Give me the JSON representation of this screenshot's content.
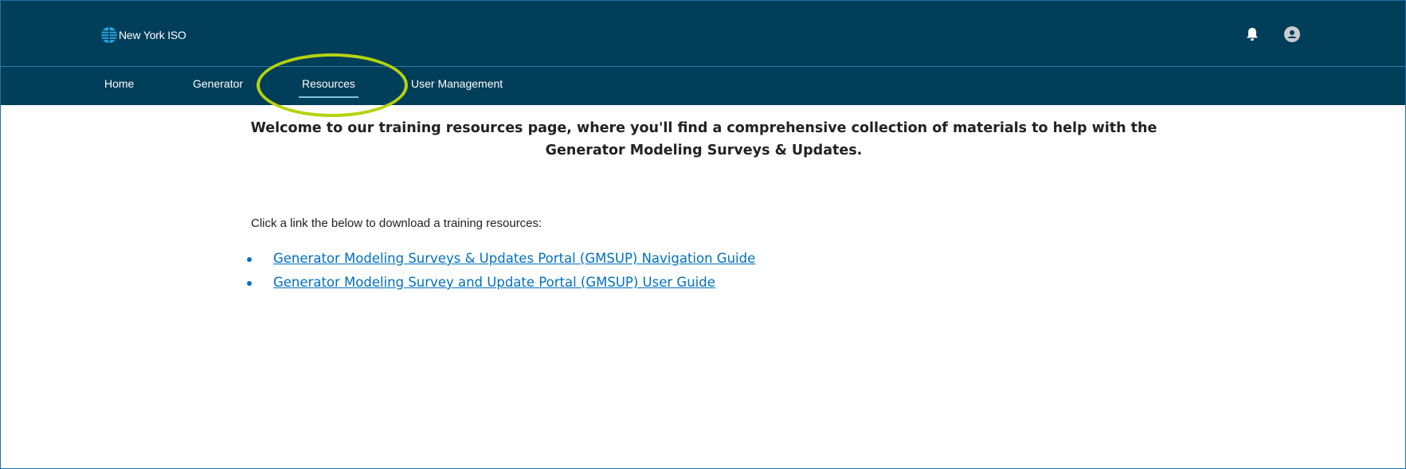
{
  "header": {
    "logo_text": "New York ISO",
    "icons": [
      "globe-logo-icon",
      "bell-icon",
      "user-avatar-icon"
    ]
  },
  "nav": {
    "items": [
      {
        "label": "Home",
        "active": false
      },
      {
        "label": "Generator",
        "active": false
      },
      {
        "label": "Resources",
        "active": true
      },
      {
        "label": "User Management",
        "active": false
      }
    ]
  },
  "main": {
    "welcome_line1": "Welcome to our training resources page, where you'll find a comprehensive collection of materials to help with the",
    "welcome_line2": "Generator Modeling Surveys & Updates.",
    "instructions": "Click a link the below to download a training resources:",
    "links": [
      {
        "label": "Generator Modeling Surveys & Updates Portal (GMSUP) Navigation Guide"
      },
      {
        "label": "Generator Modeling Survey and Update Portal (GMSUP) User Guide"
      }
    ]
  },
  "colors": {
    "header_bg": "#003e59",
    "link": "#0070c0",
    "highlight_ring": "#b5d30e",
    "active_underline": "#7fc3e3"
  }
}
